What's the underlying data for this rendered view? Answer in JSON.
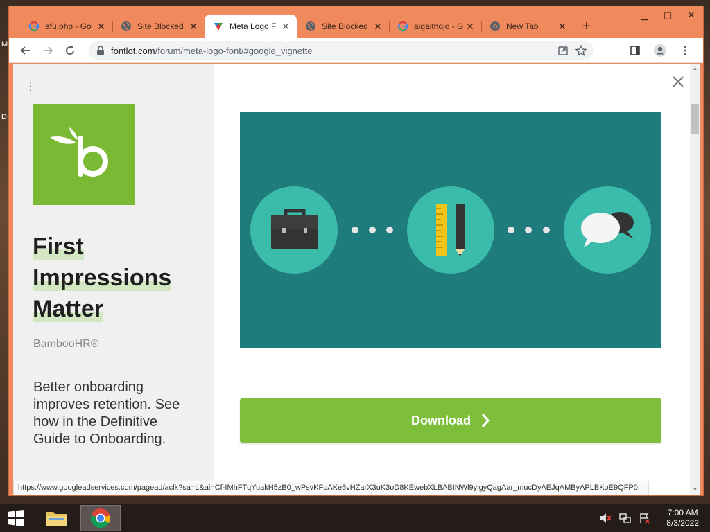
{
  "desktop": {
    "edge_letters": [
      "M",
      "D"
    ]
  },
  "window": {
    "controls": [
      "minimize",
      "maximize",
      "close"
    ]
  },
  "tabs": [
    {
      "label": "afu.php - Go",
      "favicon": "google-icon",
      "active": false
    },
    {
      "label": "Site Blocked",
      "favicon": "globe-icon",
      "active": false
    },
    {
      "label": "Meta Logo F",
      "favicon": "fontlot-icon",
      "active": true
    },
    {
      "label": "Site Blocked",
      "favicon": "globe-icon",
      "active": false
    },
    {
      "label": "aigaithojo - G",
      "favicon": "google-icon",
      "active": false
    },
    {
      "label": "New Tab",
      "favicon": "chrome-icon",
      "active": false
    }
  ],
  "address_bar": {
    "host": "fontlot.com",
    "path": "/forum/meta-logo-font/#google_vignette"
  },
  "ad": {
    "headline_lines": [
      "First",
      "Impressions",
      "Matter"
    ],
    "brand": "BambooHR®",
    "body": "Better onboarding improves retention. See how in the Definitive Guide to Onboarding."
  },
  "content": {
    "download_label": "Download"
  },
  "status_url": "https://www.googleadservices.com/pagead/aclk?sa=L&ai=Cf-IMhFTqYuakH5zB0_wPsvKFoAKe5vHZarX3uK3oD8KEwebXLBABINWl9ylgyQagAar_mucDyAEJqAMByAPLBKoE9QFP0...",
  "taskbar": {
    "time": "7:00 AM",
    "date": "8/3/2022"
  },
  "colors": {
    "chrome_frame": "#f08a5d",
    "bamboo_green": "#79b933",
    "hero_teal": "#1f7c7c",
    "download_green": "#7fbe3b"
  }
}
